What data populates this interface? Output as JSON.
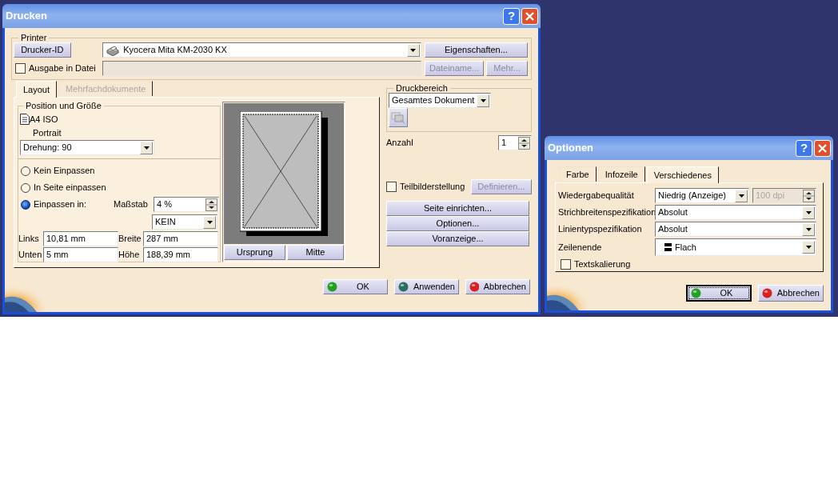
{
  "print_dialog": {
    "title": "Drucken",
    "help_glyph": "?",
    "printer": {
      "legend": "Printer",
      "id_button": "Drucker-ID",
      "printer_select": "Kyocera Mita KM-2030 KX",
      "properties_button": "Eigenschaften...",
      "output_to_file": {
        "label": "Ausgabe in Datei",
        "checked": false
      },
      "filename_button": {
        "label": "Dateiname...",
        "disabled": true
      },
      "more_button": {
        "label": "Mehr...",
        "disabled": true
      }
    },
    "tabs": [
      {
        "label": "Layout",
        "selected": true,
        "disabled": false
      },
      {
        "label": "Mehrfachdokumente",
        "selected": false,
        "disabled": true
      }
    ],
    "position": {
      "legend": "Position und Größe",
      "paper": "A4 ISO",
      "orientation": "Portrait",
      "rotation": "Drehung: 90",
      "fit_options": [
        {
          "label": "Kein Einpassen",
          "selected": false
        },
        {
          "label": "In Seite einpassen",
          "selected": false
        },
        {
          "label": "Einpassen in:",
          "selected": true
        }
      ],
      "scale_label": "Maßstab",
      "scale_value": "4 %",
      "scale_preset": "KEIN",
      "fields": [
        {
          "label": "Links",
          "value": "10,81 mm"
        },
        {
          "label": "Breite",
          "value": "287 mm"
        },
        {
          "label": "Unten",
          "value": "5 mm"
        },
        {
          "label": "Höhe",
          "value": "188,39 mm"
        }
      ]
    },
    "preview_buttons": [
      "Ursprung",
      "Mitte"
    ],
    "print_range": {
      "legend": "Druckbereich",
      "value": "Gesamtes Dokument"
    },
    "copies": {
      "label": "Anzahl",
      "value": "1"
    },
    "tiling": {
      "label": "Teilbilderstellung",
      "checked": false,
      "define_button": {
        "label": "Definieren...",
        "disabled": true
      }
    },
    "side_buttons": [
      "Seite einrichten...",
      "Optionen...",
      "Voranzeige..."
    ],
    "footer_buttons": [
      {
        "label": "OK",
        "color": "#22a022"
      },
      {
        "label": "Anwenden",
        "color": "#2a6f62"
      },
      {
        "label": "Abbrechen",
        "color": "#d82020"
      }
    ]
  },
  "options_dialog": {
    "title": "Optionen",
    "help_glyph": "?",
    "tabs": [
      {
        "label": "Farbe",
        "selected": false
      },
      {
        "label": "Infozeile",
        "selected": false
      },
      {
        "label": "Verschiedenes",
        "selected": true
      }
    ],
    "rows": [
      {
        "label": "Wiedergabequalität",
        "value": "Niedrig (Anzeige)",
        "kind": "select_dpi",
        "dpi": {
          "value": "100  dpi",
          "disabled": true
        }
      },
      {
        "label": "Strichbreitenspezifikation",
        "value": "Absolut",
        "kind": "select"
      },
      {
        "label": "Linientypspezifikation",
        "value": "Absolut",
        "kind": "select"
      },
      {
        "label": "Zeilenende",
        "value": "Flach",
        "kind": "select_icon"
      }
    ],
    "text_scaling": {
      "label": "Textskalierung",
      "checked": false
    },
    "footer_buttons": [
      {
        "label": "OK",
        "color": "#22a022",
        "focused": true
      },
      {
        "label": "Abbrechen",
        "color": "#d82020",
        "focused": false
      }
    ]
  }
}
